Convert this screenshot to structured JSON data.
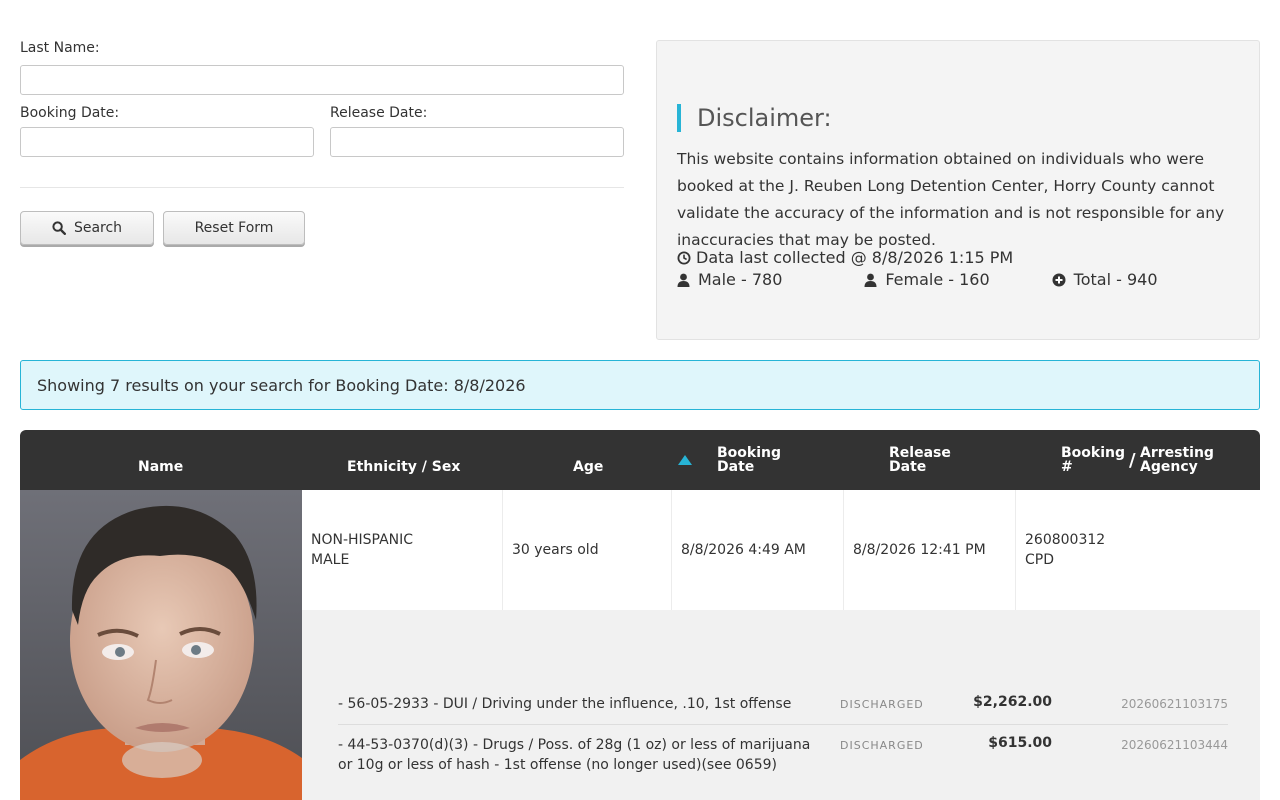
{
  "search_form": {
    "last_name_label": "Last Name:",
    "last_name_value": "",
    "booking_date_label": "Booking Date:",
    "booking_date_value": "",
    "release_date_label": "Release Date:",
    "release_date_value": "",
    "search_label": "Search",
    "reset_label": "Reset Form"
  },
  "disclaimer": {
    "title": "Disclaimer:",
    "text": "This website contains information obtained on individuals who were booked at the J. Reuben Long Detention Center, Horry County cannot validate the accuracy of the information and is not responsible for any inaccuracies that may be posted.",
    "collected": "Data last collected @ 8/8/2026 1:15 PM",
    "male": "Male - 780",
    "female": "Female - 160",
    "total": "Total - 940"
  },
  "results": {
    "summary": "Showing 7 results on your search for Booking Date: 8/8/2026"
  },
  "table": {
    "headers": {
      "name": "Name",
      "ethnicity_sex": "Ethnicity / Sex",
      "age": "Age",
      "booking_date_1": "Booking",
      "booking_date_2": "Date",
      "release_date_1": "Release",
      "release_date_2": "Date",
      "booking_num_1": "Booking",
      "booking_num_2": "#",
      "slash": "/",
      "arresting_1": "Arresting",
      "arresting_2": "Agency"
    },
    "row": {
      "ethnicity": "NON-HISPANIC",
      "sex": "MALE",
      "age": "30 years old",
      "booking_date": "8/8/2026 4:49 AM",
      "release_date": "8/8/2026 12:41 PM",
      "booking_number": "260800312",
      "agency": "CPD"
    },
    "charges": [
      {
        "description": "- 56-05-2933 - DUI / Driving under the influence, .10, 1st offense",
        "status": "DISCHARGED",
        "amount": "$2,262.00",
        "id": "20260621103175"
      },
      {
        "description": "- 44-53-0370(d)(3) - Drugs / Poss. of 28g (1 oz) or less of marijuana or 10g or less of hash - 1st offense (no longer used)(see 0659)",
        "status": "DISCHARGED",
        "amount": "$615.00",
        "id": "20260621103444"
      }
    ]
  },
  "colors": {
    "accent": "#27b4d6",
    "header_bg": "#333333",
    "alert_bg": "#dff6fb"
  }
}
